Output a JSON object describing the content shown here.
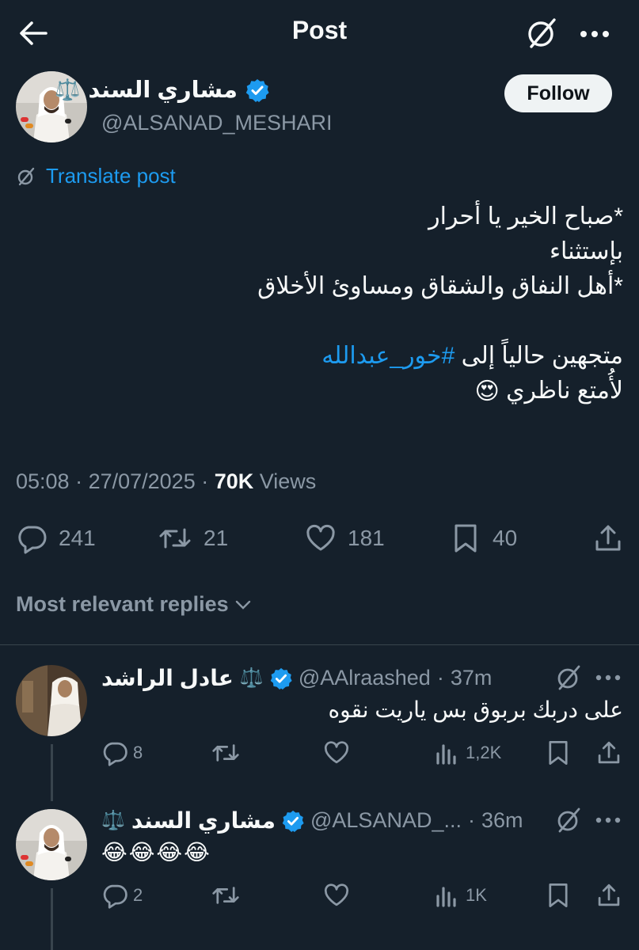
{
  "header": {
    "title": "Post"
  },
  "post": {
    "author_name": "مشاري السند",
    "scales_emoji": "⚖️",
    "handle": "@ALSANAD_MESHARI",
    "follow_label": "Follow",
    "translate_label": "Translate post",
    "text_line1": "*صباح الخير يا أحرار",
    "text_line2": "بإستثناء",
    "text_line3": "*أهل النفاق والشقاق ومساوئ الأخلاق",
    "text_line4_prefix": "متجهين حالياً إلى ",
    "hashtag": "#خور_عبدالله",
    "text_line5": "لأُمتع ناظري",
    "emoji_heart_eyes": "😍",
    "time": "05:08",
    "date": "27/07/2025",
    "views_count": "70K",
    "views_label": "Views",
    "replies": "241",
    "reposts": "21",
    "likes": "181",
    "bookmarks": "40"
  },
  "sort": {
    "label": "Most relevant replies"
  },
  "replies": [
    {
      "name": "عادل الراشد",
      "scales": "⚖️",
      "handle": "@AAlraashed",
      "time": "37m",
      "text": "على دربك بربوق بس ياريت نقوه",
      "replies": "8",
      "reposts": "",
      "likes": "",
      "views": "1,2K"
    },
    {
      "name": "مشاري السند",
      "scales": "⚖️",
      "handle": "@ALSANAD_...",
      "time": "36m",
      "text": "😂😂😂😂",
      "replies": "2",
      "reposts": "",
      "likes": "",
      "views": "1K"
    }
  ],
  "colors": {
    "background": "#15202b",
    "text": "#f7f9f9",
    "muted": "#8b98a5",
    "accent": "#1d9bf0",
    "divider": "#38444d",
    "follow_bg": "#eff3f4"
  }
}
